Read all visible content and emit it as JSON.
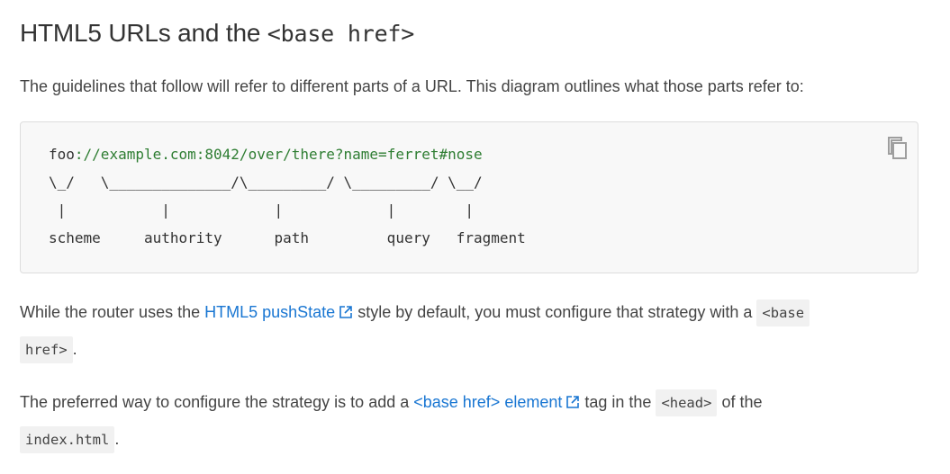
{
  "heading": {
    "text": "HTML5 URLs and the ",
    "code": "<base href>"
  },
  "intro": "The guidelines that follow will refer to different parts of a URL. This diagram outlines what those parts refer to:",
  "code_block": {
    "line1_scheme": "foo",
    "line1_rest": "://example.com:8042/over/there?name=ferret#nose",
    "line2": "\\_/   \\______________/\\_________/ \\_________/ \\__/",
    "line3": " |           |            |            |        |",
    "line4": "scheme     authority      path         query   fragment",
    "copy_icon": "copy-icon"
  },
  "para1": {
    "before_link": "While the router uses the ",
    "link": "HTML5 pushState",
    "after_link": " style by default, you must configure that strategy with a ",
    "code": "<base",
    "code2": "href>",
    "end": "."
  },
  "para2": {
    "before_link": "The preferred way to configure the strategy is to add a ",
    "link": "<base href> element",
    "after_link": " tag in the ",
    "code": "<head>",
    "after_code": " of the",
    "code2": "index.html",
    "end": "."
  },
  "colors": {
    "link": "#1976d2",
    "code_string": "#2e7d32",
    "code_bg": "#f8f8f8"
  }
}
